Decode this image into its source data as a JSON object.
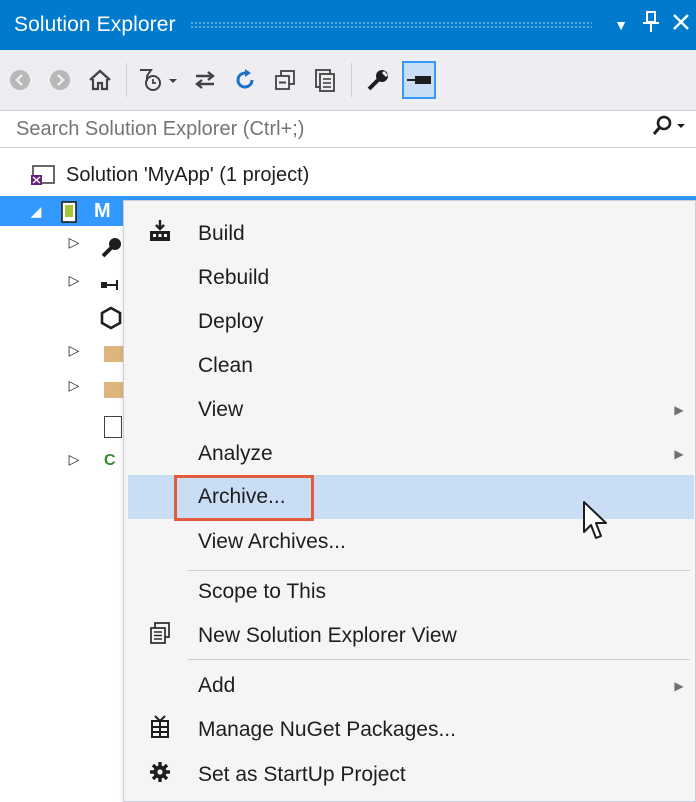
{
  "window": {
    "title": "Solution Explorer",
    "pin_glyph": "▼",
    "autohide_glyph": "📌",
    "close_glyph": "✕"
  },
  "toolbar": {
    "icons": [
      "back-icon",
      "forward-icon",
      "home-icon",
      "pending-changes-filter-icon",
      "sync-with-active-document-icon",
      "refresh-icon",
      "collapse-all-icon",
      "show-all-files-icon",
      "properties-icon",
      "preview-selected-items-icon"
    ]
  },
  "search": {
    "placeholder": "Search Solution Explorer (Ctrl+;)",
    "icon_glyph": "⚲ ▾"
  },
  "tree": {
    "solution_label": "Solution 'MyApp' (1 project)",
    "project_label": "MyApp",
    "project_visible_label": "M"
  },
  "context_menu": {
    "items": [
      {
        "label": "Build",
        "icon": "build-icon",
        "glyph": "⊞"
      },
      {
        "label": "Rebuild"
      },
      {
        "label": "Deploy"
      },
      {
        "label": "Clean"
      },
      {
        "label": "View",
        "submenu": true
      },
      {
        "label": "Analyze",
        "submenu": true
      },
      {
        "label": "Archive...",
        "highlighted": true
      },
      {
        "label": "View Archives..."
      },
      {
        "label": "Scope to This"
      },
      {
        "label": "New Solution Explorer View",
        "icon": "new-view-icon"
      },
      {
        "label": "Add",
        "submenu": true
      },
      {
        "label": "Manage NuGet Packages...",
        "icon": "nuget-icon"
      },
      {
        "label": "Set as StartUp Project",
        "icon": "gear-icon"
      }
    ],
    "submenu_arrow": "▶"
  },
  "colors": {
    "title_bg": "#007acc",
    "selection_bg": "#3399ff",
    "menu_hover_bg": "#c9def5",
    "highlight_border": "#e25c3b"
  }
}
